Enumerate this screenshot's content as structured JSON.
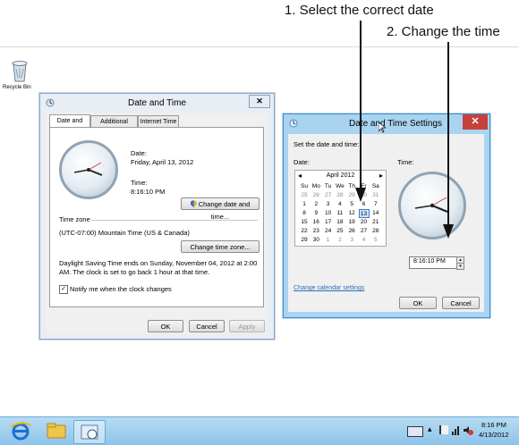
{
  "callouts": {
    "step1": "1. Select the correct date",
    "step2": "2. Change the time"
  },
  "desktop": {
    "recycle_bin_label": "Recycle Bin"
  },
  "date_time_dialog": {
    "title": "Date and Time",
    "close_glyph": "✕",
    "tabs": [
      "Date and Time",
      "Additional Clocks",
      "Internet Time"
    ],
    "date_label": "Date:",
    "date_value": "Friday, April 13, 2012",
    "time_label": "Time:",
    "time_value": "8:16:10 PM",
    "change_datetime_button": "Change date and time...",
    "timezone_heading": "Time zone",
    "timezone_value": "(UTC-07:00) Mountain Time (US & Canada)",
    "change_timezone_button": "Change time zone...",
    "dst_notice": "Daylight Saving Time ends on Sunday, November 04, 2012 at 2:00 AM. The clock is set to go back 1 hour at that time.",
    "notify_checkbox": "Notify me when the clock changes",
    "ok_button": "OK",
    "cancel_button": "Cancel",
    "apply_button": "Apply"
  },
  "settings_dialog": {
    "title": "Date and Time Settings",
    "close_glyph": "✕",
    "instruction": "Set the date and time:",
    "date_label": "Date:",
    "time_label": "Time:",
    "calendar": {
      "prev_glyph": "◂",
      "next_glyph": "▸",
      "month_label": "April 2012",
      "weekdays": [
        "Su",
        "Mo",
        "Tu",
        "We",
        "Th",
        "Fr",
        "Sa"
      ],
      "weeks": [
        [
          "25",
          "26",
          "27",
          "28",
          "29",
          "30",
          "31"
        ],
        [
          "1",
          "2",
          "3",
          "4",
          "5",
          "6",
          "7"
        ],
        [
          "8",
          "9",
          "10",
          "11",
          "12",
          "13",
          "14"
        ],
        [
          "15",
          "16",
          "17",
          "18",
          "19",
          "20",
          "21"
        ],
        [
          "22",
          "23",
          "24",
          "25",
          "26",
          "27",
          "28"
        ],
        [
          "29",
          "30",
          "1",
          "2",
          "3",
          "4",
          "5"
        ]
      ],
      "selected_day": "13"
    },
    "time_value": "8:16:10 PM",
    "change_calendar_link": "Change calendar settings",
    "ok_button": "OK",
    "cancel_button": "Cancel"
  },
  "taskbar": {
    "clock_time": "8:16 PM",
    "clock_date": "4/13/2012",
    "pinned": [
      "internet-explorer-icon",
      "file-explorer-icon",
      "date-time-app-icon"
    ]
  },
  "colors": {
    "active_frame": "#a8d4f0",
    "inactive_frame": "#e8eef4",
    "close_button": "#c7413a",
    "taskbar": "#8cc4ea",
    "link": "#2a6fb8"
  }
}
